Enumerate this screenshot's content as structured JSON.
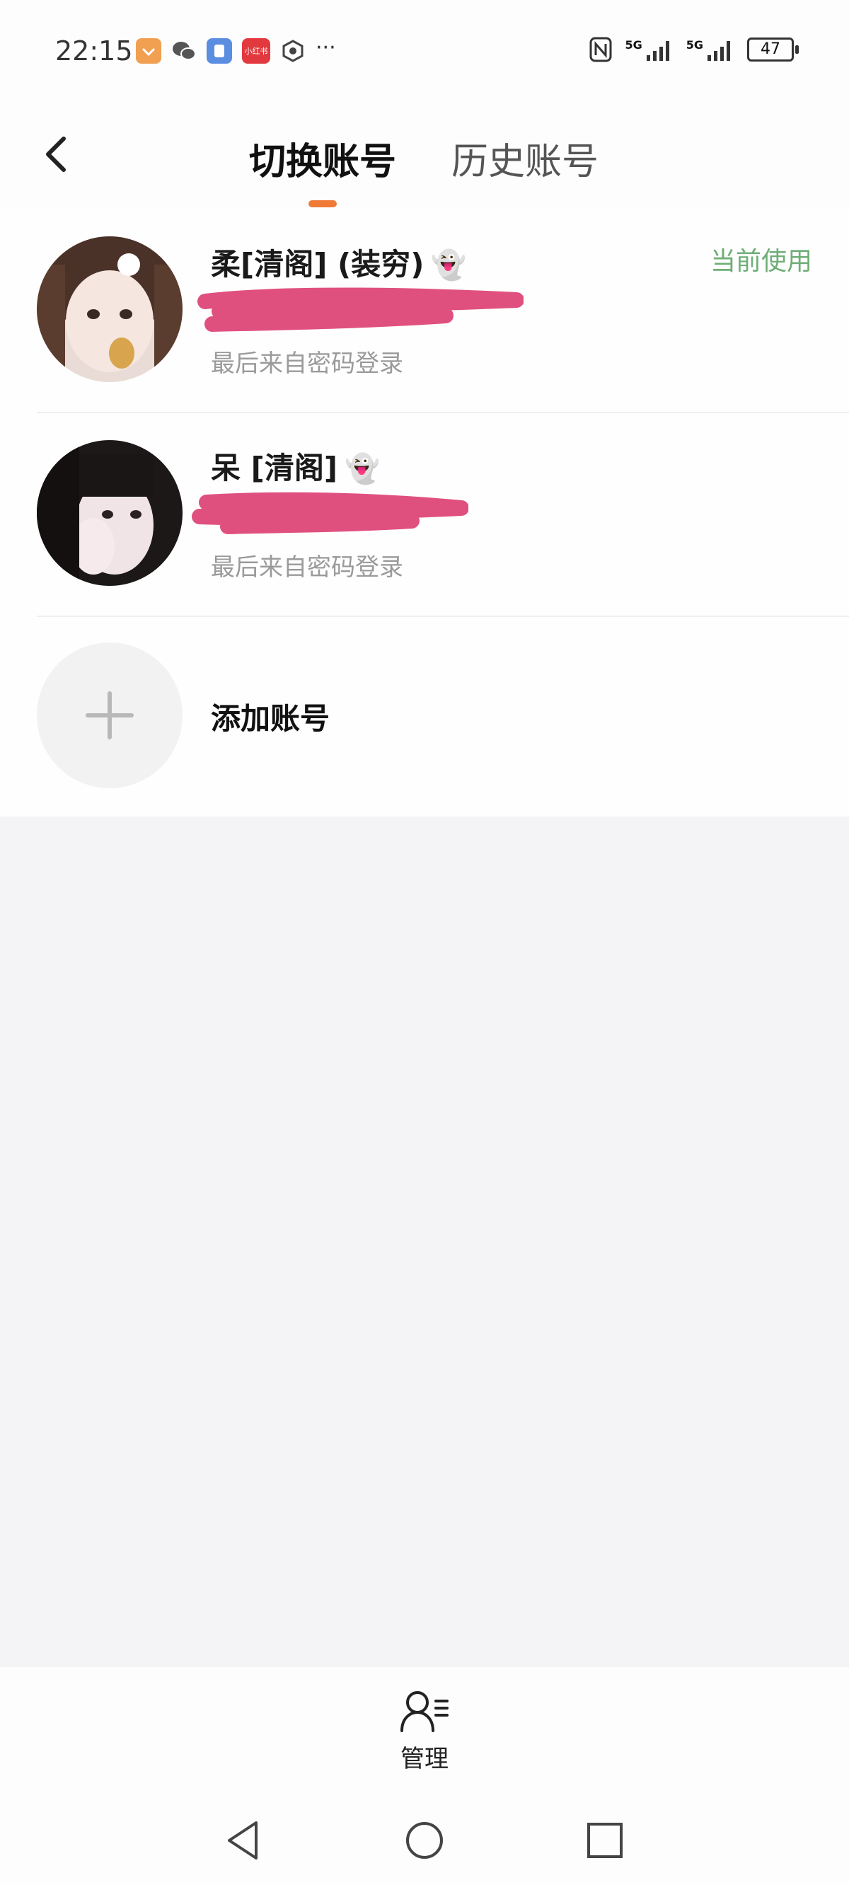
{
  "status_bar": {
    "time": "22:15",
    "notification_icons": [
      "taobao-icon",
      "wechat-icon",
      "app-icon",
      "xiaohongshu-icon",
      "hand-icon"
    ],
    "xiaohongshu_label": "小红书",
    "more": "···",
    "signal_labels": [
      "5G",
      "5G"
    ],
    "battery": "47"
  },
  "header": {
    "tabs": [
      {
        "label": "切换账号",
        "active": true
      },
      {
        "label": "历史账号",
        "active": false
      }
    ],
    "accent_color": "#ef7a35"
  },
  "accounts": [
    {
      "name": "柔[清阁] (装穷)",
      "emoji": "👻",
      "subtitle": "最后来自密码登录",
      "tag": "当前使用"
    },
    {
      "name": "呆 [清阁]",
      "emoji": "👻",
      "subtitle": "最后来自密码登录",
      "tag": ""
    }
  ],
  "add_account": {
    "label": "添加账号"
  },
  "bottom": {
    "manage_label": "管理"
  },
  "colors": {
    "tag_green": "#6fae77",
    "redaction_pink": "#e0507f",
    "background": "#f4f3f6"
  }
}
